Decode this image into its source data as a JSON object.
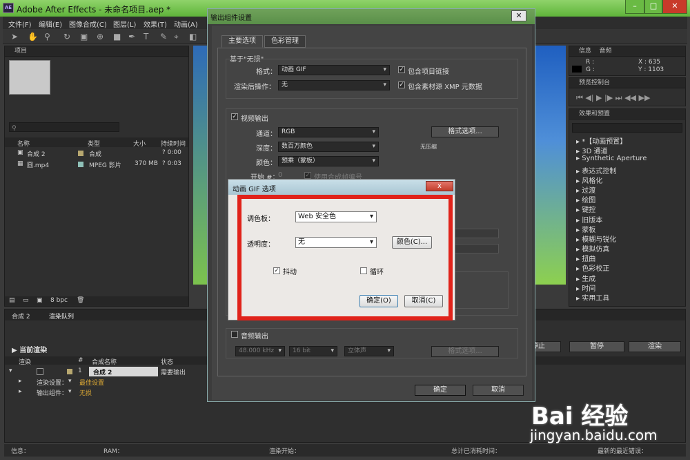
{
  "app": {
    "title": "Adobe After Effects - 未命名项目.aep *",
    "logo_text": "AE",
    "menus": [
      "文件(F)",
      "编辑(E)",
      "图像合成(C)",
      "图层(L)",
      "效果(T)",
      "动画(A)"
    ]
  },
  "project_panel": {
    "tab": "项目",
    "columns": [
      "名称",
      "类型",
      "大小",
      "持续时间"
    ],
    "items": [
      {
        "name": "合成 2",
        "type": "合成",
        "size": "",
        "duration": "? 0:00"
      },
      {
        "name": "圆.mp4",
        "type": "MPEG 影片",
        "size": "370 MB",
        "duration": "? 0:03"
      }
    ],
    "bpc": "8 bpc"
  },
  "info_panel": {
    "tabs": [
      "信息",
      "音频"
    ],
    "r": "R :",
    "g": "G :",
    "x": "X : 635",
    "y": "Y : 1103",
    "preview_tab": "预览控制台"
  },
  "effects_panel": {
    "tab": "效果和预置",
    "items": [
      "*【动画预置】",
      "3D 通道",
      "Synthetic Aperture",
      "表达式控制",
      "风格化",
      "过渡",
      "绘图",
      "键控",
      "旧版本",
      "蒙板",
      "模糊与锐化",
      "模拟仿真",
      "扭曲",
      "色彩校正",
      "生成",
      "时间",
      "实用工具"
    ]
  },
  "render_queue": {
    "tabs": [
      "合成 2",
      "渲染队列"
    ],
    "current_render": "当前渲染",
    "columns": [
      "渲染",
      "#",
      "合成名称",
      "状态"
    ],
    "row": {
      "index": "1",
      "comp": "合成 2",
      "status": "需要输出"
    },
    "render_settings_label": "渲染设置：",
    "render_settings_value": "最佳设置",
    "output_module_label": "输出组件：",
    "output_module_value": "无损",
    "stop": "停止",
    "pause": "暂停",
    "render": "渲染"
  },
  "status_bar": {
    "info": "信息：",
    "ram": "RAM：",
    "render_start": "渲染开始：",
    "total_time": "总计已消耗时间：",
    "recent_error": "最新的最近错误："
  },
  "output_module_dialog": {
    "title": "输出组件设置",
    "tabs": [
      "主要选项",
      "色彩管理"
    ],
    "based_on": "基于\"无损\"",
    "format_label": "格式：",
    "format_value": "动画 GIF",
    "include_project_link": "包含项目链接",
    "post_render_label": "渲染后操作：",
    "post_render_value": "无",
    "include_xmp": "包含素材源 XMP 元数据",
    "video_output": "视频输出",
    "channels_label": "通道：",
    "channels_value": "RGB",
    "format_options": "格式选项...",
    "depth_label": "深度：",
    "depth_value": "数百万颜色",
    "compression": "无压缩",
    "color_label": "颜色：",
    "color_value": "预乘（蒙板）",
    "start_label": "开始 #：",
    "start_value": "0",
    "use_comp_frame": "使用合成帧编号",
    "audio_output": "音频输出",
    "audio_rate": "48.000 kHz",
    "audio_bits": "16 bit",
    "audio_channels": "立体声",
    "audio_format_options": "格式选项...",
    "ok": "确定",
    "cancel": "取消"
  },
  "gif_dialog": {
    "title": "动画 GIF 选项",
    "close": "x",
    "palette_label": "调色板：",
    "palette_value": "Web 安全色",
    "transparency_label": "透明度：",
    "transparency_value": "无",
    "color_button": "颜色(C)...",
    "dither": "抖动",
    "loop": "循环",
    "ok": "确定(O)",
    "cancel": "取消(C)"
  },
  "watermark": {
    "line1": "Bai 经验",
    "line2": "jingyan.baidu.com"
  },
  "colors": {
    "accent_green": "#74c44a",
    "highlight_red": "#e0221a",
    "panel_dark": "#2f2f2f"
  }
}
